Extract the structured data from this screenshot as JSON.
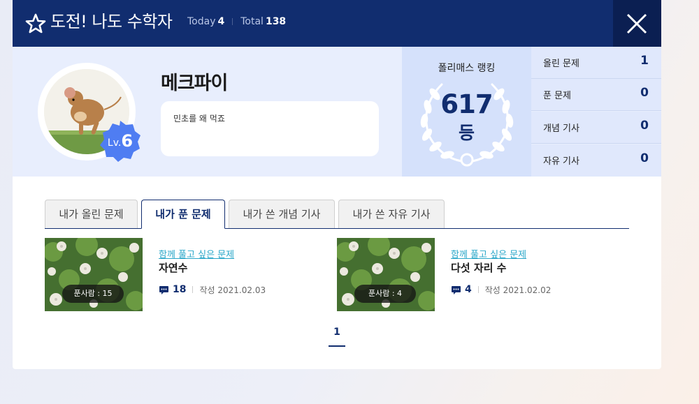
{
  "header": {
    "title": "도전! 나도 수학자",
    "today_label": "Today",
    "today_value": "4",
    "total_label": "Total",
    "total_value": "138"
  },
  "profile": {
    "nickname": "메크파이",
    "level_prefix": "Lv.",
    "level": "6",
    "bio": "민초를 왜 먹죠"
  },
  "ranking": {
    "label": "폴리매스 랭킹",
    "value": "617",
    "unit": "등"
  },
  "stats": [
    {
      "label": "올린 문제",
      "value": "1"
    },
    {
      "label": "푼 문제",
      "value": "0"
    },
    {
      "label": "개념 기사",
      "value": "0"
    },
    {
      "label": "자유 기사",
      "value": "0"
    }
  ],
  "tabs": [
    {
      "label": "내가 올린 문제"
    },
    {
      "label": "내가 푼 문제"
    },
    {
      "label": "내가 쓴 개념 기사"
    },
    {
      "label": "내가 쓴 자유 기사"
    }
  ],
  "cards": [
    {
      "solvers": "푼사람 : 15",
      "category": "함께 풀고 싶은 문제",
      "title": "자연수",
      "comments": "18",
      "date": "작성 2021.02.03"
    },
    {
      "solvers": "푼사람 : 4",
      "category": "함께 풀고 싶은 문제",
      "title": "다섯 자리 수",
      "comments": "4",
      "date": "작성 2021.02.02"
    }
  ],
  "pagination": {
    "current": "1"
  },
  "colors": {
    "navy": "#112d6f",
    "accent_cyan": "#2aa7c9",
    "badge_blue": "#4f7df2"
  },
  "icons": [
    "star-icon",
    "close-icon",
    "laurel-icon",
    "comment-icon"
  ]
}
